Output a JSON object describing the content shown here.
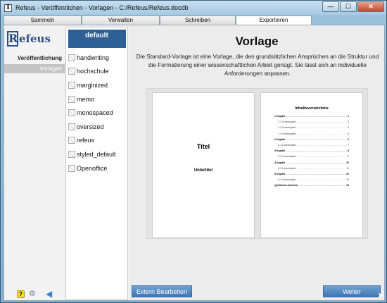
{
  "window": {
    "title": "Refeus - Veröffentlichen - Vorlagen - C:/Refeus/Refeus.docdb",
    "app_icon": "I",
    "controls": {
      "minimize": "—",
      "maximize": "☐",
      "close": "✕"
    }
  },
  "tabs": [
    {
      "label": "Sammeln"
    },
    {
      "label": "Verwalten"
    },
    {
      "label": "Schreiben"
    },
    {
      "label": "Exportieren"
    }
  ],
  "sidebar": {
    "logo_letter": "R",
    "logo_text": "efeus",
    "section": "Veröffentlichung",
    "active_item": "Vorlagen",
    "icons": [
      "help-icon",
      "gear-icon",
      "back-arrow-icon"
    ]
  },
  "templates": {
    "selected": "default",
    "items": [
      "handwriting",
      "hochschule",
      "marginized",
      "memo",
      "monospaced",
      "oversized",
      "refeus",
      "styled_default",
      "Openoffice"
    ]
  },
  "main": {
    "title": "Vorlage",
    "description": "Die Standard-Vorlage ist eine Vorlage, die den grundsätzlichen Ansprüchen an die Struktur und die Formatierung einer wissenschaftlichen Arbeit genügt. Sie lässt sich an individuelle Anforderungen anpassen.",
    "preview": {
      "title_page": {
        "title": "Titel",
        "subtitle": "Untertitel"
      },
      "toc": {
        "heading": "Inhaltsverzeichnis",
        "rows": [
          {
            "label": "1 Kapitel",
            "page": "2",
            "level": 1
          },
          {
            "label": "1.1 Unterkapitel",
            "page": "3",
            "level": 2
          },
          {
            "label": "1.2 Unterkapitel",
            "page": "3",
            "level": 2
          },
          {
            "label": "1.3 Unterkapitel",
            "page": "5",
            "level": 2
          },
          {
            "label": "2 Kapitel",
            "page": "6",
            "level": 1
          },
          {
            "label": "2.1 Unterkapitel",
            "page": "7",
            "level": 2
          },
          {
            "label": "3 Kapitel",
            "page": "8",
            "level": 1
          },
          {
            "label": "3.1 Unterkapitel",
            "page": "9",
            "level": 2
          },
          {
            "label": "4 Kapitel",
            "page": "10",
            "level": 1
          },
          {
            "label": "4.1 Unterkapitel",
            "page": "11",
            "level": 2
          },
          {
            "label": "5 Kapitel",
            "page": "12",
            "level": 1
          },
          {
            "label": "5.1 Unterkapitel",
            "page": "13",
            "level": 2
          },
          {
            "label": "Quellenverzeichnis",
            "page": "14",
            "level": 1
          }
        ]
      }
    },
    "buttons": {
      "edit": "Extern Bearbeiten",
      "next": "Weiter"
    }
  },
  "colors": {
    "accent": "#2e5f95",
    "button": "#4a82bf",
    "help": "#f3dc32"
  }
}
